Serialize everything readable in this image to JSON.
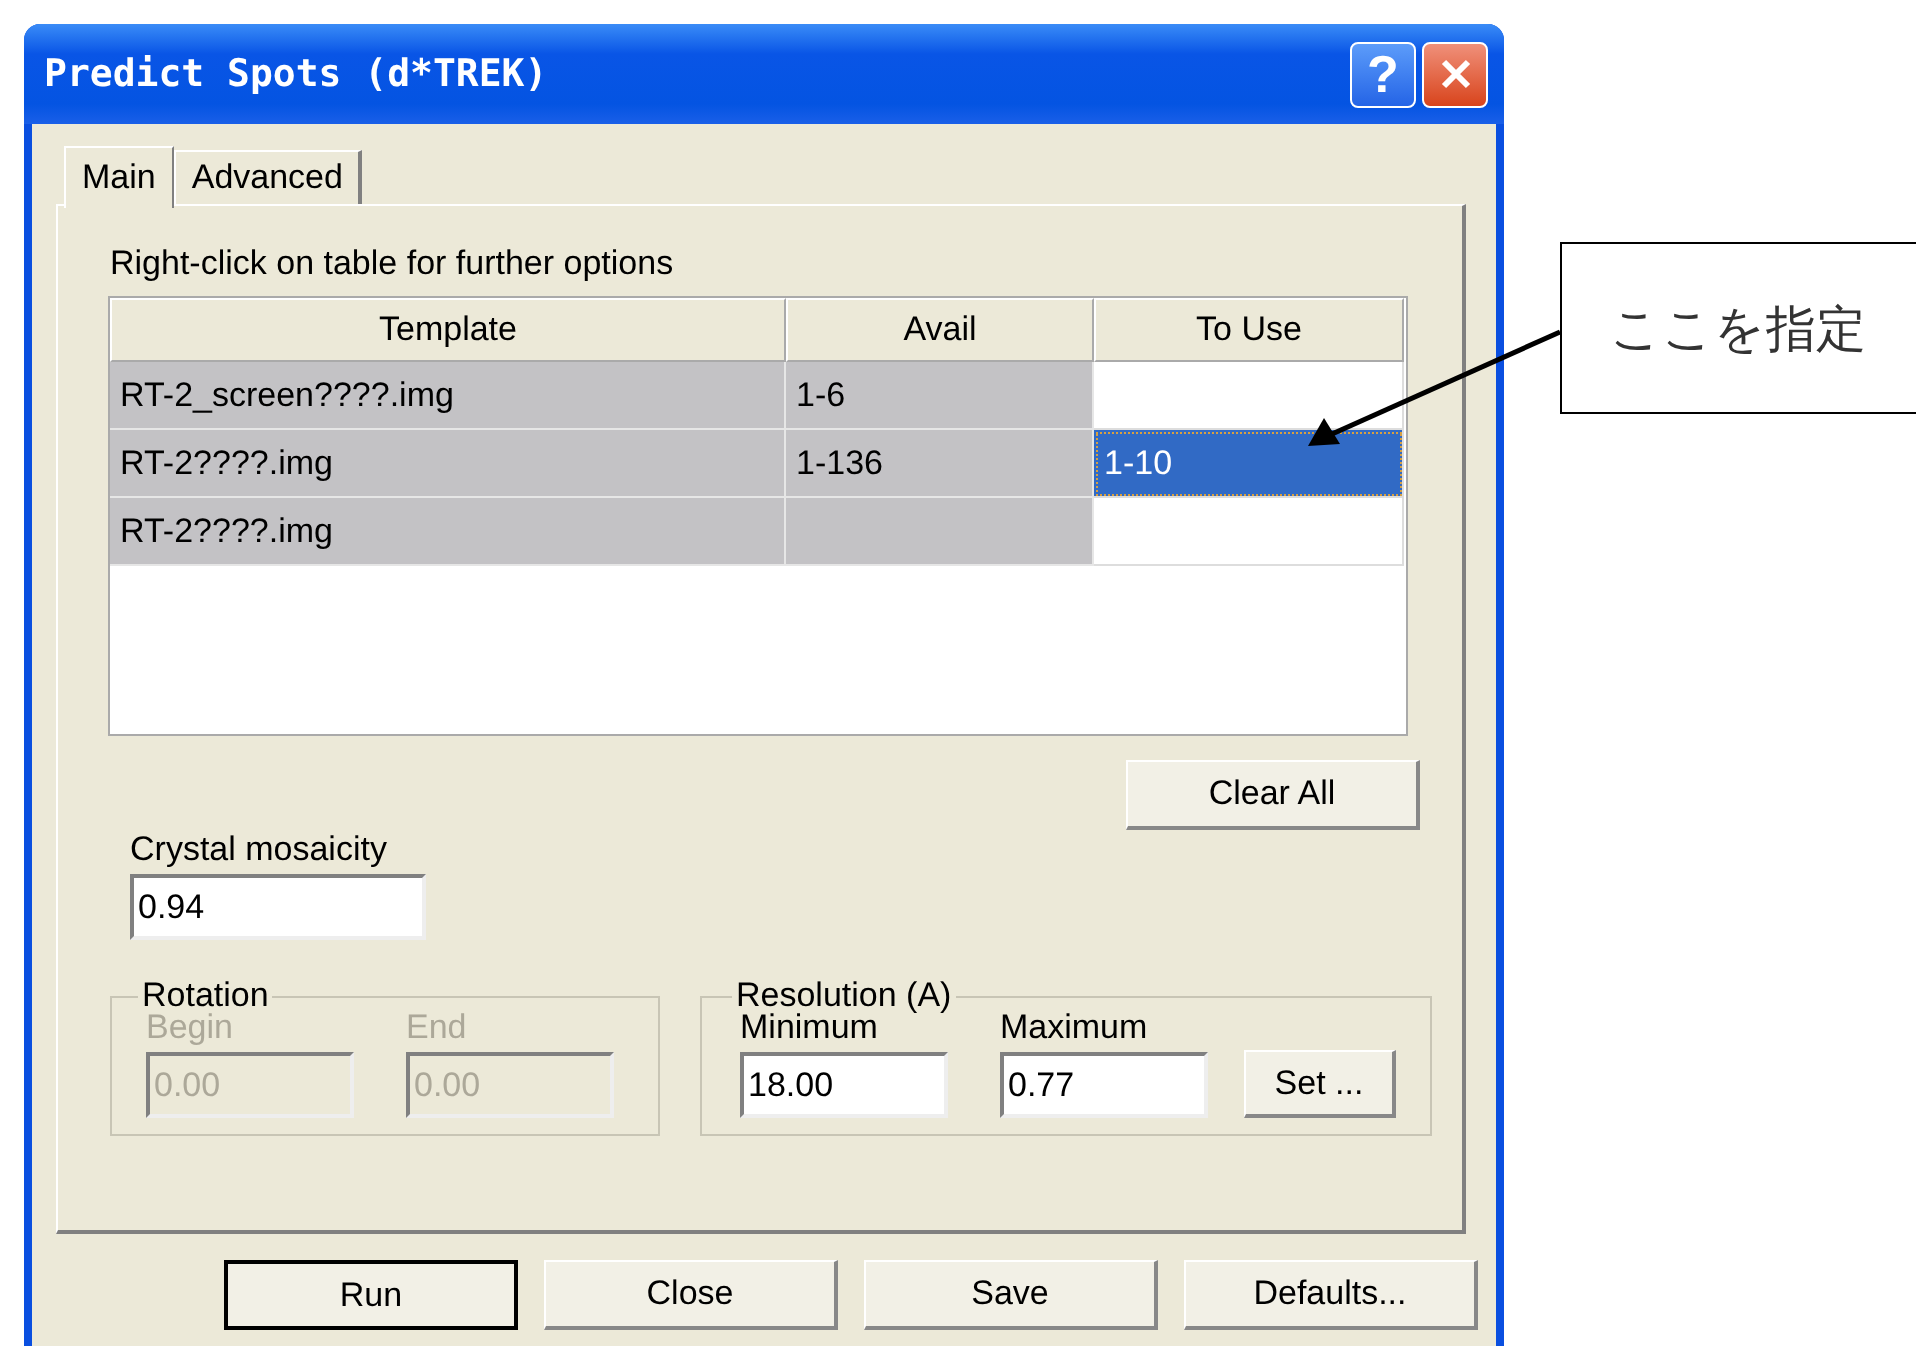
{
  "window": {
    "title": "Predict Spots (d*TREK)",
    "help_label": "?"
  },
  "tabs": [
    {
      "label": "Main",
      "selected": true
    },
    {
      "label": "Advanced",
      "selected": false
    }
  ],
  "hint": "Right-click on table for further options",
  "table": {
    "columns": [
      "Template",
      "Avail",
      "To Use"
    ],
    "rows": [
      {
        "template": "RT-2_screen????.img",
        "avail": "1-6",
        "selected": false
      },
      {
        "template": "RT-2????.img",
        "avail": "1-136",
        "to_use": "1-10",
        "selected": true
      },
      {
        "template": "RT-2????.img",
        "selected": false
      }
    ]
  },
  "clear_all": "Clear All",
  "mosaicity": {
    "label": "Crystal mosaicity",
    "value": "0.94"
  },
  "groups": [
    {
      "legend": "Rotation",
      "fields": [
        {
          "label": "Begin",
          "value": "0.00",
          "disabled": true
        },
        {
          "label": "End",
          "value": "0.00",
          "disabled": true
        }
      ]
    },
    {
      "legend": "Resolution (A)",
      "fields": [
        {
          "label": "Minimum",
          "value": "18.00",
          "disabled": false
        },
        {
          "label": "Maximum",
          "value": "0.77",
          "disabled": false
        }
      ],
      "button": "Set ..."
    }
  ],
  "buttons": [
    {
      "label": "Run",
      "default": true
    },
    {
      "label": "Close",
      "default": false
    },
    {
      "label": "Save",
      "default": false
    },
    {
      "label": "Defaults...",
      "default": false
    }
  ],
  "annotation": {
    "text": "ここを指定"
  }
}
